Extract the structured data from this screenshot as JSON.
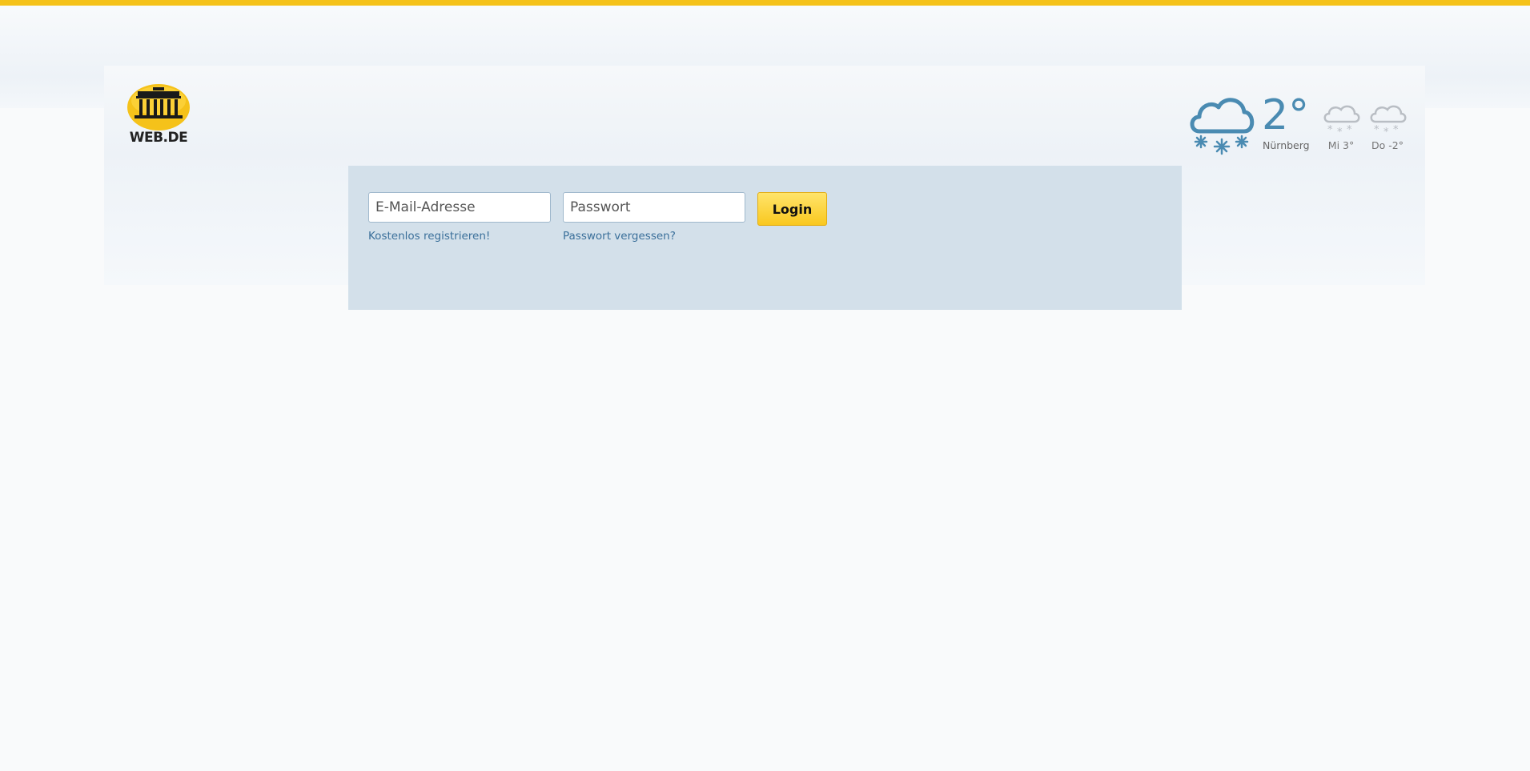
{
  "brand": {
    "logo_text": "WEB.DE",
    "accent_color": "#f5c21a",
    "logo_icon": "brandenburg-gate-icon"
  },
  "weather": {
    "current": {
      "icon": "snow-cloud-icon",
      "temperature": "2°",
      "city": "Nürnberg"
    },
    "forecast": [
      {
        "icon": "snow-cloud-icon",
        "label": "Mi 3°"
      },
      {
        "icon": "snow-cloud-icon",
        "label": "Do -2°"
      }
    ],
    "color": "#4a8bb2"
  },
  "login": {
    "email_placeholder": "E-Mail-Adresse",
    "email_value": "",
    "password_placeholder": "Passwort",
    "password_value": "",
    "submit_label": "Login",
    "register_link": "Kostenlos registrieren!",
    "forgot_link": "Passwort vergessen?",
    "panel_color": "#d3e0ea",
    "button_color": "#f9c81f"
  }
}
